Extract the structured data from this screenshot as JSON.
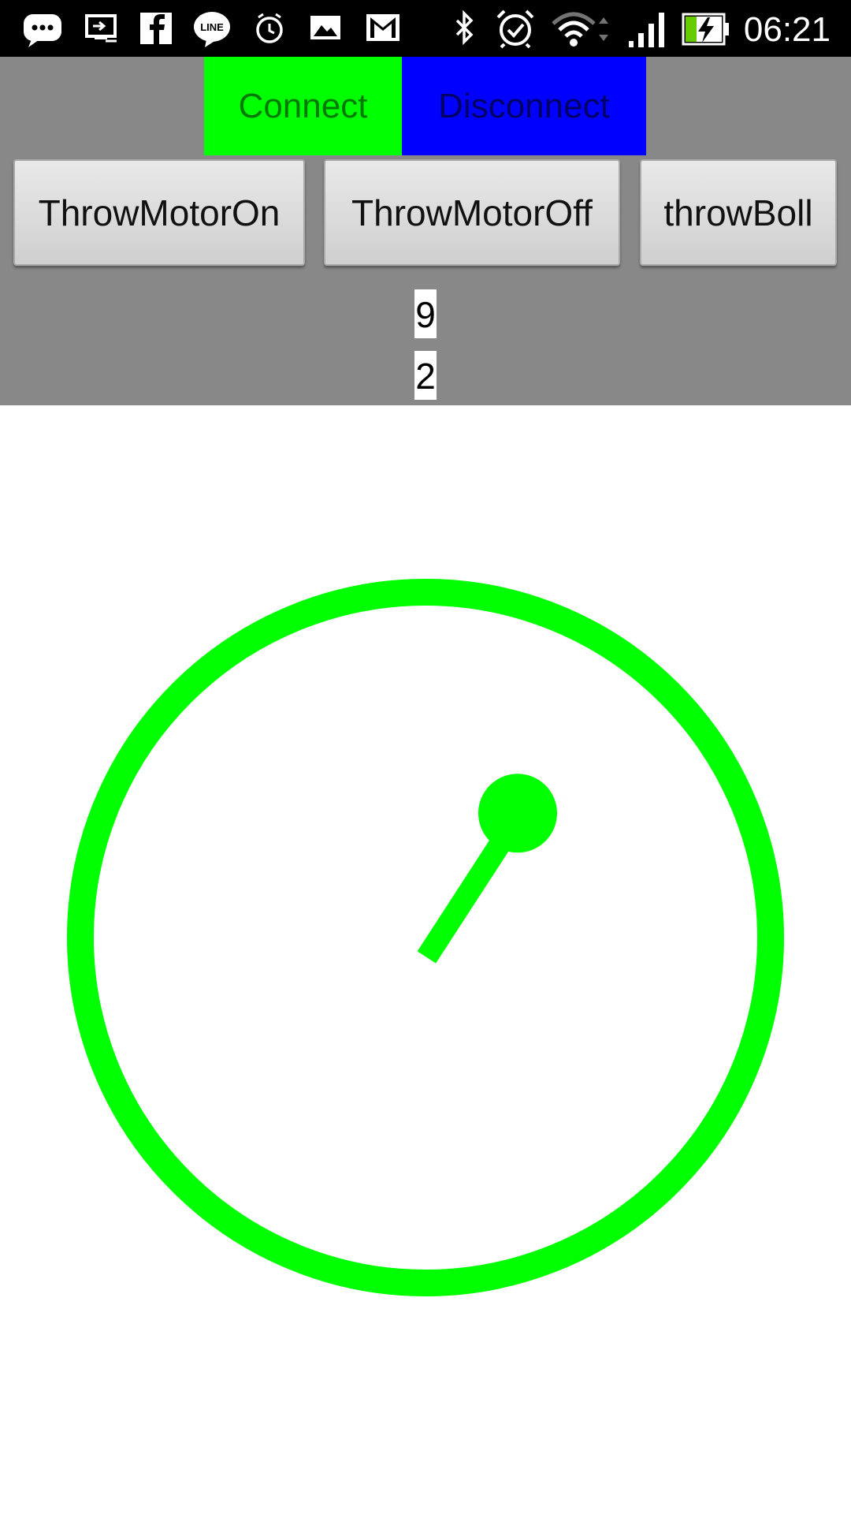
{
  "status_bar": {
    "time": "06:21",
    "left_icons": [
      "chat-bubble-icon",
      "screen-share-icon",
      "facebook-icon",
      "line-icon",
      "alarm-clock-icon",
      "gallery-icon",
      "gmail-icon"
    ],
    "right_icons": [
      "bluetooth-icon",
      "alarm-icon",
      "wifi-icon",
      "signal-icon",
      "battery-charging-icon"
    ],
    "line_logo_text": "LINE"
  },
  "controls": {
    "connect_label": "Connect",
    "disconnect_label": "Disconnect",
    "connect_color": "#00ff00",
    "disconnect_color": "#0000ff",
    "throw_motor_on_label": "ThrowMotorOn",
    "throw_motor_off_label": "ThrowMotorOff",
    "throw_boll_label": "throwBoll",
    "value_1": "9",
    "value_2": "2",
    "panel_color": "#888888"
  },
  "joystick": {
    "color": "#00ff00",
    "stick_angle_deg": 52
  }
}
